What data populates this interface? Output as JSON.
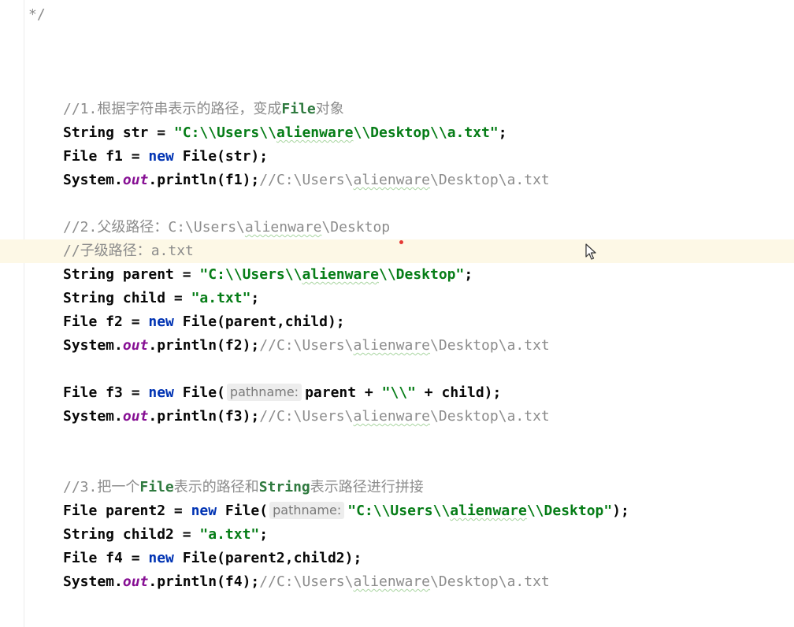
{
  "editor": {
    "lines": [
      {
        "row": "r00",
        "indent": 0,
        "current": false,
        "tokens": [
          {
            "t": "comment",
            "v": "*/"
          }
        ]
      },
      {
        "row": "r04",
        "indent": 2,
        "current": false,
        "tokens": [
          {
            "t": "comment",
            "v": "//1."
          },
          {
            "t": "comment-cjk",
            "v": "根据字符串表示的路径，变成"
          },
          {
            "t": "comment-bold",
            "v": "File"
          },
          {
            "t": "comment-cjk",
            "v": "对象"
          }
        ]
      },
      {
        "row": "r05",
        "indent": 2,
        "current": false,
        "tokens": [
          {
            "t": "plain",
            "v": "String str = "
          },
          {
            "t": "str",
            "v": "\"C:\\\\Users\\\\"
          },
          {
            "t": "str-typo",
            "v": "alienware"
          },
          {
            "t": "str",
            "v": "\\\\Desktop\\\\a.txt\""
          },
          {
            "t": "plain",
            "v": ";"
          }
        ]
      },
      {
        "row": "r06",
        "indent": 2,
        "current": false,
        "tokens": [
          {
            "t": "plain",
            "v": "File f1 = "
          },
          {
            "t": "kw",
            "v": "new"
          },
          {
            "t": "plain",
            "v": " File(str);"
          }
        ]
      },
      {
        "row": "r07",
        "indent": 2,
        "current": false,
        "tokens": [
          {
            "t": "plain",
            "v": "System."
          },
          {
            "t": "field",
            "v": "out"
          },
          {
            "t": "plain",
            "v": ".println(f1);"
          },
          {
            "t": "comment",
            "v": "//C:\\Users\\"
          },
          {
            "t": "comment-typo",
            "v": "alienware"
          },
          {
            "t": "comment",
            "v": "\\Desktop\\a.txt"
          }
        ]
      },
      {
        "row": "r09",
        "indent": 2,
        "current": false,
        "tokens": [
          {
            "t": "comment",
            "v": "//2."
          },
          {
            "t": "comment-cjk",
            "v": "父级路径："
          },
          {
            "t": "comment",
            "v": "C:\\Users\\"
          },
          {
            "t": "comment-typo",
            "v": "alienware"
          },
          {
            "t": "comment",
            "v": "\\Desktop"
          }
        ]
      },
      {
        "row": "r10",
        "indent": 2,
        "current": true,
        "tokens": [
          {
            "t": "comment",
            "v": "//"
          },
          {
            "t": "comment-cjk",
            "v": "子级路径："
          },
          {
            "t": "comment",
            "v": "a.txt"
          }
        ]
      },
      {
        "row": "r11",
        "indent": 2,
        "current": false,
        "tokens": [
          {
            "t": "plain",
            "v": "String parent = "
          },
          {
            "t": "str",
            "v": "\"C:\\\\Users\\\\"
          },
          {
            "t": "str-typo",
            "v": "alienware"
          },
          {
            "t": "str",
            "v": "\\\\Desktop\""
          },
          {
            "t": "plain",
            "v": ";"
          }
        ]
      },
      {
        "row": "r12",
        "indent": 2,
        "current": false,
        "tokens": [
          {
            "t": "plain",
            "v": "String child = "
          },
          {
            "t": "str",
            "v": "\"a.txt\""
          },
          {
            "t": "plain",
            "v": ";"
          }
        ]
      },
      {
        "row": "r13",
        "indent": 2,
        "current": false,
        "tokens": [
          {
            "t": "plain",
            "v": "File f2 = "
          },
          {
            "t": "kw",
            "v": "new"
          },
          {
            "t": "plain",
            "v": " File(parent,child);"
          }
        ]
      },
      {
        "row": "r14",
        "indent": 2,
        "current": false,
        "tokens": [
          {
            "t": "plain",
            "v": "System."
          },
          {
            "t": "field",
            "v": "out"
          },
          {
            "t": "plain",
            "v": ".println(f2);"
          },
          {
            "t": "comment",
            "v": "//C:\\Users\\"
          },
          {
            "t": "comment-typo",
            "v": "alienware"
          },
          {
            "t": "comment",
            "v": "\\Desktop\\a.txt"
          }
        ]
      },
      {
        "row": "r16",
        "indent": 2,
        "current": false,
        "tokens": [
          {
            "t": "plain",
            "v": "File f3 = "
          },
          {
            "t": "kw",
            "v": "new"
          },
          {
            "t": "plain",
            "v": " File("
          },
          {
            "t": "hint",
            "v": "pathname:"
          },
          {
            "t": "plain",
            "v": "parent + "
          },
          {
            "t": "str",
            "v": "\"\\\\\""
          },
          {
            "t": "plain",
            "v": " + child);"
          }
        ]
      },
      {
        "row": "r17",
        "indent": 2,
        "current": false,
        "tokens": [
          {
            "t": "plain",
            "v": "System."
          },
          {
            "t": "field",
            "v": "out"
          },
          {
            "t": "plain",
            "v": ".println(f3);"
          },
          {
            "t": "comment",
            "v": "//C:\\Users\\"
          },
          {
            "t": "comment-typo",
            "v": "alienware"
          },
          {
            "t": "comment",
            "v": "\\Desktop\\a.txt"
          }
        ]
      },
      {
        "row": "r20",
        "indent": 2,
        "current": false,
        "tokens": [
          {
            "t": "comment",
            "v": "//3."
          },
          {
            "t": "comment-cjk",
            "v": "把一个"
          },
          {
            "t": "comment-bold",
            "v": "File"
          },
          {
            "t": "comment-cjk",
            "v": "表示的路径和"
          },
          {
            "t": "comment-bold",
            "v": "String"
          },
          {
            "t": "comment-cjk",
            "v": "表示路径进行拼接"
          }
        ]
      },
      {
        "row": "r21",
        "indent": 2,
        "current": false,
        "tokens": [
          {
            "t": "plain",
            "v": "File parent2 = "
          },
          {
            "t": "kw",
            "v": "new"
          },
          {
            "t": "plain",
            "v": " File("
          },
          {
            "t": "hint",
            "v": "pathname:"
          },
          {
            "t": "str",
            "v": "\"C:\\\\Users\\\\"
          },
          {
            "t": "str-typo",
            "v": "alienware"
          },
          {
            "t": "str",
            "v": "\\\\Desktop\""
          },
          {
            "t": "plain",
            "v": ");"
          }
        ]
      },
      {
        "row": "r22",
        "indent": 2,
        "current": false,
        "tokens": [
          {
            "t": "plain",
            "v": "String child2 = "
          },
          {
            "t": "str",
            "v": "\"a.txt\""
          },
          {
            "t": "plain",
            "v": ";"
          }
        ]
      },
      {
        "row": "r23",
        "indent": 2,
        "current": false,
        "tokens": [
          {
            "t": "plain",
            "v": "File f4 = "
          },
          {
            "t": "kw",
            "v": "new"
          },
          {
            "t": "plain",
            "v": " File(parent2,child2);"
          }
        ]
      },
      {
        "row": "r24",
        "indent": 2,
        "current": false,
        "tokens": [
          {
            "t": "plain",
            "v": "System."
          },
          {
            "t": "field",
            "v": "out"
          },
          {
            "t": "plain",
            "v": ".println(f4);"
          },
          {
            "t": "comment",
            "v": "//C:\\Users\\"
          },
          {
            "t": "comment-typo",
            "v": "alienware"
          },
          {
            "t": "comment",
            "v": "\\Desktop\\a.txt"
          }
        ]
      }
    ]
  },
  "colors": {
    "keyword": "#0033b3",
    "string": "#067d17",
    "comment": "#8c8c8c",
    "field": "#871094",
    "current_line": "#fdf8e6",
    "caret": "#e53935"
  },
  "icons": {
    "mouse_cursor": "arrow-cursor-icon"
  }
}
